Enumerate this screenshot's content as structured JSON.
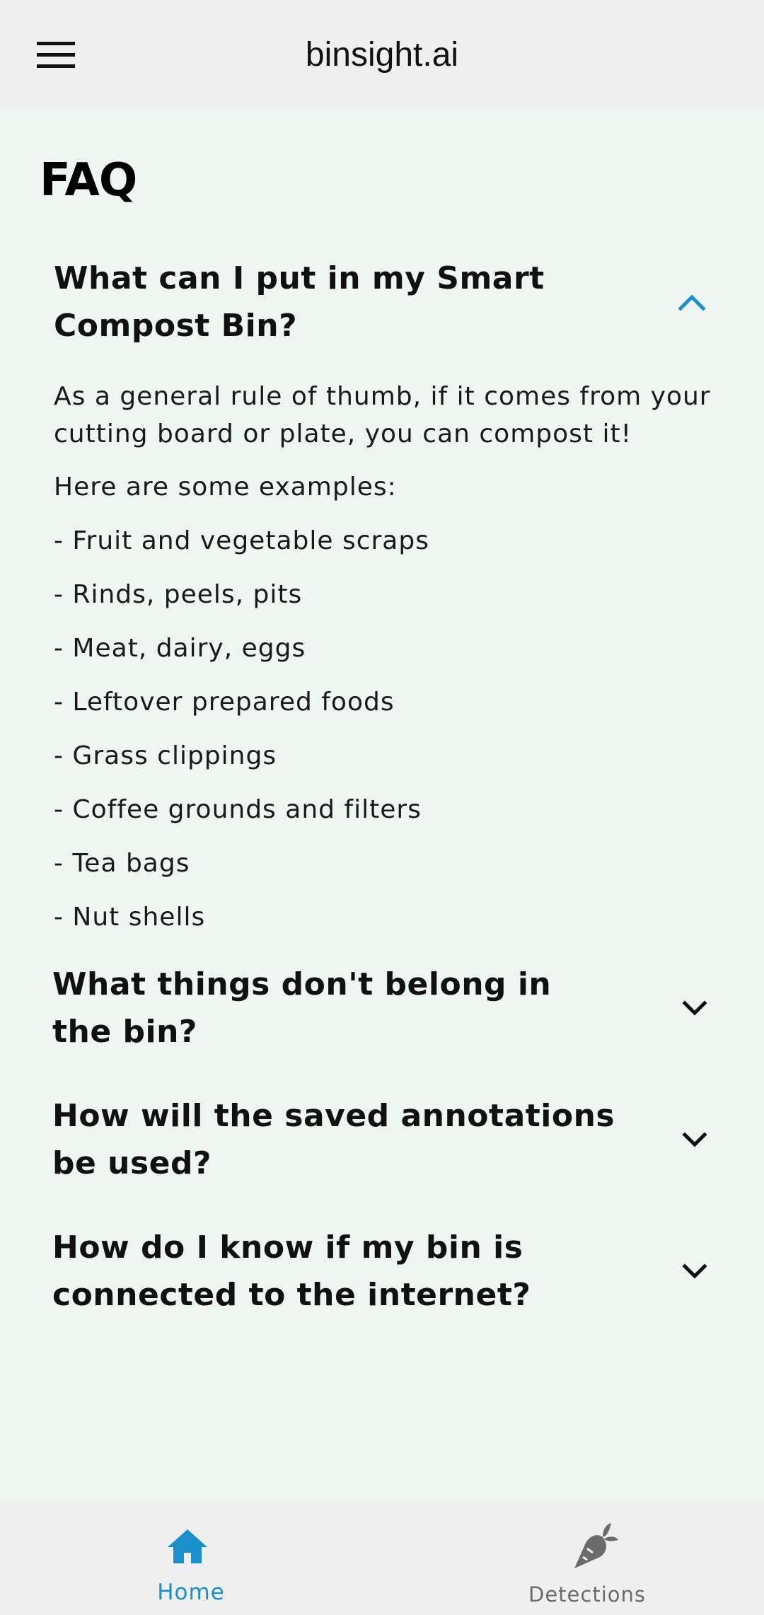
{
  "header": {
    "title": "binsight.ai"
  },
  "page": {
    "heading": "FAQ"
  },
  "faq": [
    {
      "question": "What can I put in my Smart Compost Bin?",
      "expanded": true,
      "answer": {
        "intro": "As a general rule of thumb, if it comes from your cutting board or plate, you can compost it!",
        "examples_heading": "Here are some examples:",
        "examples": [
          "- Fruit and vegetable scraps",
          "- Rinds, peels, pits",
          "- Meat, dairy, eggs",
          "- Leftover prepared foods",
          "- Grass clippings",
          "- Coffee grounds and filters",
          "- Tea bags",
          "- Nut shells"
        ]
      }
    },
    {
      "question": "What things don't belong in the bin?",
      "expanded": false
    },
    {
      "question": "How will the saved annotations be used?",
      "expanded": false
    },
    {
      "question": "How do I know if my bin is connected to the internet?",
      "expanded": false
    }
  ],
  "bottom_nav": {
    "tabs": [
      {
        "label": "Home",
        "icon": "home-icon",
        "active": true
      },
      {
        "label": "Detections",
        "icon": "carrot-icon",
        "active": false
      }
    ]
  },
  "colors": {
    "accent": "#1a8fc9",
    "inactive": "#6b6b6b",
    "bar_background": "#efefef",
    "page_background": "#eef6f2"
  }
}
